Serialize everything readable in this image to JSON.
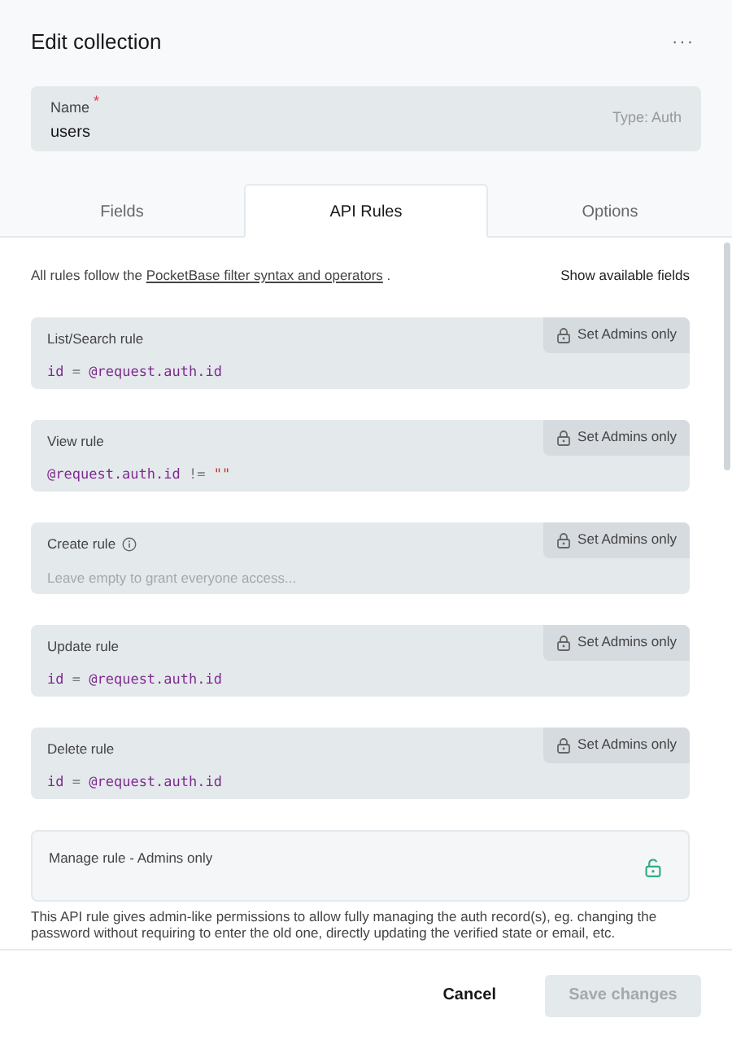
{
  "header": {
    "title": "Edit collection",
    "menu": "···"
  },
  "name_field": {
    "label": "Name",
    "required": "*",
    "value": "users",
    "type_label": "Type: Auth"
  },
  "tabs": [
    {
      "label": "Fields",
      "selected": false
    },
    {
      "label": "API Rules",
      "selected": true
    },
    {
      "label": "Options",
      "selected": false
    }
  ],
  "intro": {
    "text": "All rules follow the",
    "link": "PocketBase filter syntax and operators",
    "after": ".",
    "show_fields": "Show available fields"
  },
  "rules": [
    {
      "label": "List/Search rule",
      "info": false,
      "value": "id = @request.auth.id",
      "button": "Set Admins only"
    },
    {
      "label": "View rule",
      "info": false,
      "value": "@request.auth.id != \"\"",
      "button": "Set Admins only"
    },
    {
      "label": "Create rule",
      "info": true,
      "placeholder": "Leave empty to grant everyone access...",
      "button": "Set Admins only"
    },
    {
      "label": "Update rule",
      "info": false,
      "value": "id = @request.auth.id",
      "button": "Set Admins only"
    },
    {
      "label": "Delete rule",
      "info": false,
      "value": "id = @request.auth.id",
      "button": "Set Admins only"
    }
  ],
  "manage_rule": {
    "label": "Manage rule - Admins only",
    "locked": false,
    "description": "This API rule gives admin-like permissions to allow fully managing the auth record(s), eg. changing the password without requiring to enter the old one, directly updating the verified state or email, etc."
  },
  "footer": {
    "cancel": "Cancel",
    "save": "Save changes",
    "save_disabled": true
  }
}
